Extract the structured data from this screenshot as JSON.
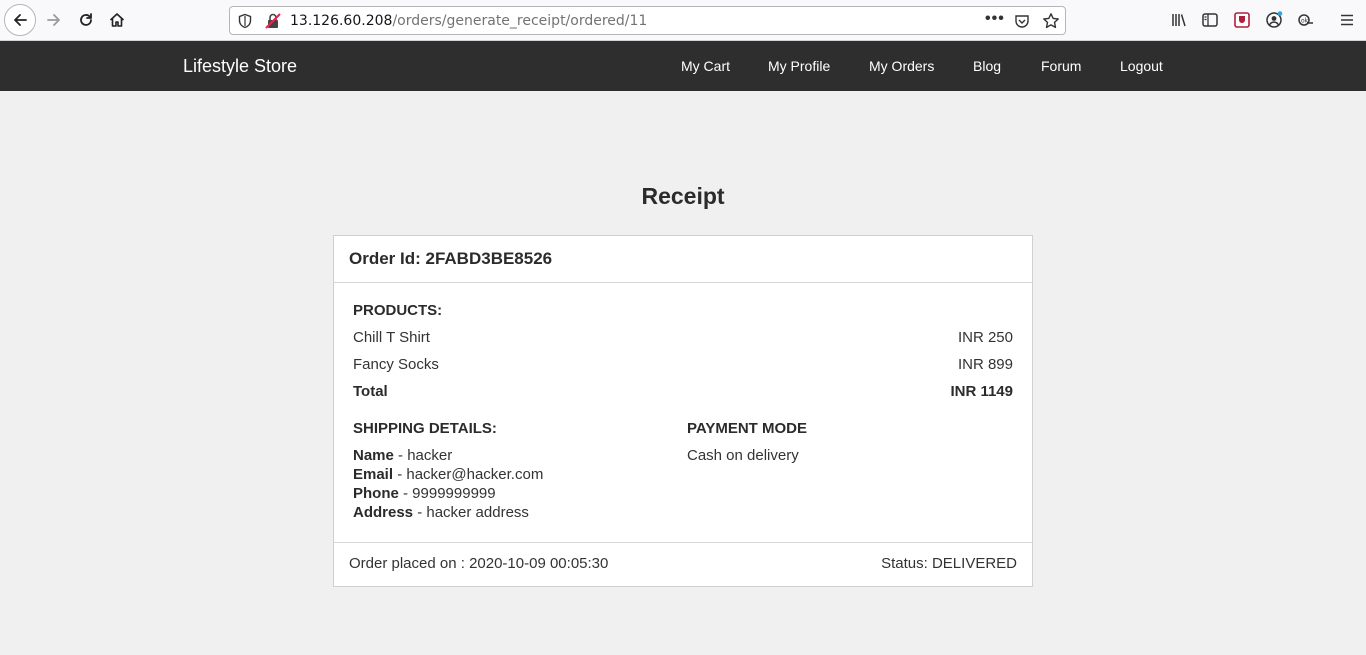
{
  "browser": {
    "url_host": "13.126.60.208",
    "url_path": "/orders/generate_receipt/ordered/11",
    "more_label": "•••"
  },
  "navbar": {
    "brand": "Lifestyle Store",
    "links": [
      "My Cart",
      "My Profile",
      "My Orders",
      "Blog",
      "Forum",
      "Logout"
    ]
  },
  "receipt": {
    "title": "Receipt",
    "order_id": "Order Id: 2FABD3BE8526",
    "products_heading": "PRODUCTS:",
    "products": [
      {
        "name": "Chill T Shirt",
        "price": "INR 250"
      },
      {
        "name": "Fancy Socks",
        "price": "INR 899"
      }
    ],
    "total_label": "Total",
    "total_value": "INR 1149",
    "shipping_heading": "SHIPPING DETAILS:",
    "shipping": {
      "name_label": "Name",
      "name_value": " - hacker",
      "email_label": "Email",
      "email_value": " - hacker@hacker.com",
      "phone_label": "Phone",
      "phone_value": " - 9999999999",
      "address_label": "Address",
      "address_value": " - hacker address"
    },
    "payment_heading": "PAYMENT MODE",
    "payment_value": "Cash on delivery",
    "placed_on": "Order placed on : 2020-10-09 00:05:30",
    "status": "Status: DELIVERED"
  }
}
